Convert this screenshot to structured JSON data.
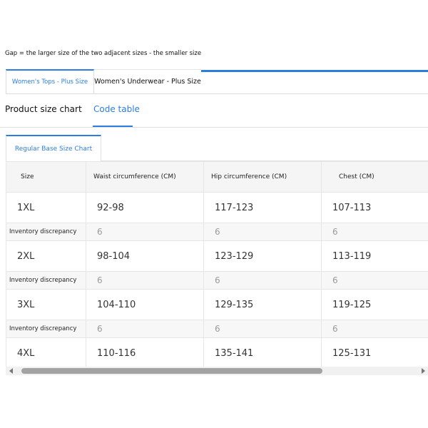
{
  "note": "Gap = the larger size of the two adjacent sizes - the smaller size",
  "category_tabs": {
    "active": "Women's Tops - Plus Size",
    "inactive": "Women's Underwear - Plus Size"
  },
  "section_tabs": {
    "product": "Product size chart",
    "code": "Code table"
  },
  "sub_tab": "Regular Base Size Chart",
  "table": {
    "headers": [
      "Size",
      "Waist circumference (CM)",
      "Hip circumference (CM)",
      "Chest (CM)"
    ],
    "rows": [
      {
        "type": "size",
        "cells": [
          "1XL",
          "92-98",
          "117-123",
          "107-113"
        ]
      },
      {
        "type": "disc",
        "cells": [
          "Inventory discrepancy",
          "6",
          "6",
          "6"
        ]
      },
      {
        "type": "size",
        "cells": [
          "2XL",
          "98-104",
          "123-129",
          "113-119"
        ]
      },
      {
        "type": "disc",
        "cells": [
          "Inventory discrepancy",
          "6",
          "6",
          "6"
        ]
      },
      {
        "type": "size",
        "cells": [
          "3XL",
          "104-110",
          "129-135",
          "119-125"
        ]
      },
      {
        "type": "disc",
        "cells": [
          "Inventory discrepancy",
          "6",
          "6",
          "6"
        ]
      },
      {
        "type": "size",
        "cells": [
          "4XL",
          "110-116",
          "135-141",
          "125-131"
        ]
      }
    ]
  },
  "scrollbar": {
    "left_icon": "arrow-left-icon",
    "right_icon": "arrow-right-icon"
  }
}
